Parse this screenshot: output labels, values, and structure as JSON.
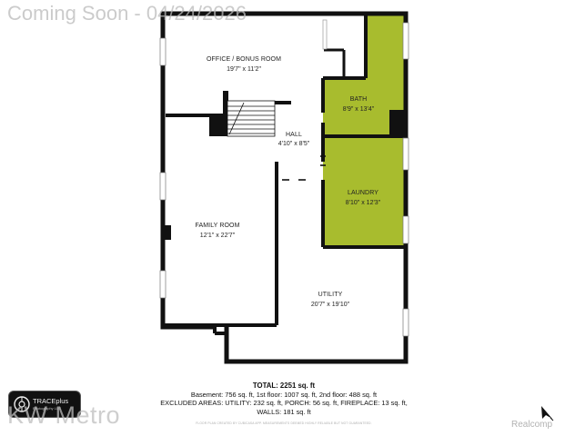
{
  "watermark": {
    "top": "Coming Soon - 04/24/2026",
    "bottom": "KW Metro",
    "realcomp": "Realcomp"
  },
  "rooms": [
    {
      "id": "office",
      "name": "OFFICE / BONUS ROOM",
      "dims": "19'7\" x 11'2\""
    },
    {
      "id": "bath",
      "name": "BATH",
      "dims": "8'9\" x 13'4\""
    },
    {
      "id": "hall",
      "name": "HALL",
      "dims": "4'10\" x 8'5\""
    },
    {
      "id": "laundry",
      "name": "LAUNDRY",
      "dims": "8'10\" x 12'3\""
    },
    {
      "id": "family",
      "name": "FAMILY ROOM",
      "dims": "12'1\" x 22'7\""
    },
    {
      "id": "utility",
      "name": "UTILITY",
      "dims": "20'7\" x 19'10\""
    }
  ],
  "colors": {
    "highlight": "#a8bc2e",
    "wall": "#111111"
  },
  "totals": {
    "total": "TOTAL: 2251 sq. ft",
    "floors": "Basement: 756 sq. ft, 1st floor: 1007 sq. ft, 2nd floor: 488 sq. ft",
    "excluded": "EXCLUDED AREAS: UTILITY: 232 sq. ft, PORCH: 56 sq. ft, FIREPLACE: 13 sq. ft,",
    "walls": "WALLS: 181 sq. ft"
  },
  "fine_print": "FLOOR PLAN CREATED BY CUBICASA APP. MEASUREMENTS DEEMED HIGHLY RELIABLE BUT NOT GUARANTEED.",
  "logo": {
    "name": "TRACEplus",
    "subtitle": "Photography LLC"
  },
  "icons": {
    "north_arrow": "north-arrow-icon",
    "logo_mark": "camera-aperture-icon"
  }
}
